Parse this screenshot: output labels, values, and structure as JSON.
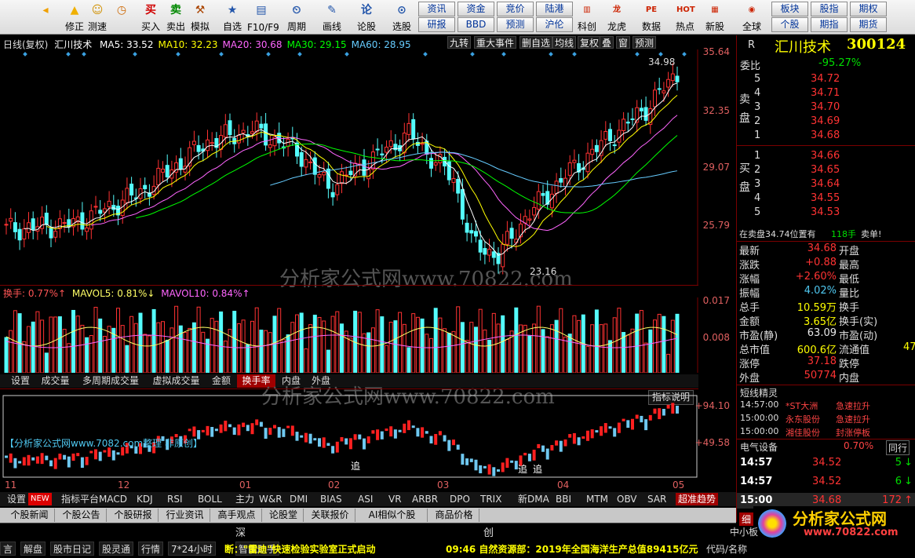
{
  "toolbar": {
    "items": [
      {
        "label": "",
        "icon": "◂",
        "name": "back-icon"
      },
      {
        "label": "修正",
        "icon": "▲",
        "name": "up-arrow-icon"
      },
      {
        "label": "测速",
        "icon": "☺",
        "name": "smiley-icon"
      },
      {
        "label": "",
        "icon": "◷",
        "name": "clock-icon"
      },
      {
        "label": "买入",
        "icon": "买",
        "name": "buy-icon"
      },
      {
        "label": "卖出",
        "icon": "卖",
        "name": "sell-icon"
      },
      {
        "label": "模拟",
        "icon": "⚒",
        "name": "hammer-icon"
      },
      {
        "label": "自选",
        "icon": "★",
        "name": "star-icon"
      },
      {
        "label": "F10/F9",
        "icon": "▤",
        "name": "f10-icon"
      },
      {
        "label": "周期",
        "icon": "⏲",
        "name": "period-icon"
      },
      {
        "label": "画线",
        "icon": "✎",
        "name": "pencil-icon"
      },
      {
        "label": "论股",
        "icon": "论",
        "name": "discuss-icon"
      },
      {
        "label": "选股",
        "icon": "⊙",
        "name": "select-stock-icon"
      }
    ],
    "mini": [
      "资讯",
      "资金",
      "竞价",
      "陆港",
      "研报",
      "BBD",
      "预测",
      "沪伦"
    ],
    "right_items": [
      {
        "label": "科创",
        "icon": "▥",
        "name": "chart-icon"
      },
      {
        "label": "龙虎",
        "icon": "龙",
        "name": "dragon-icon"
      },
      {
        "label": "数据",
        "icon": "PE",
        "name": "pe-icon"
      },
      {
        "label": "热点",
        "icon": "HOT",
        "name": "hot-icon"
      },
      {
        "label": "新股",
        "icon": "▦",
        "name": "ipo-icon"
      },
      {
        "label": "全球",
        "icon": "◉",
        "name": "globe-icon"
      }
    ],
    "mini_right": [
      "板块",
      "股指",
      "期权",
      "个股",
      "期指",
      "期货"
    ]
  },
  "chart": {
    "title_left": "日线(复权)",
    "stock": "汇川技术",
    "ma": [
      {
        "label": "MA5: 33.52",
        "color": "#ffffff"
      },
      {
        "label": "MA10: 32.23",
        "color": "#ffff00"
      },
      {
        "label": "MA20: 30.68",
        "color": "#ff66ff"
      },
      {
        "label": "MA30: 29.15",
        "color": "#00ff00"
      },
      {
        "label": "MA60: 28.95",
        "color": "#66ccff"
      }
    ],
    "top_buttons": [
      "九转",
      "重大事件",
      "删自选",
      "均线",
      "复权",
      "叠",
      "窗",
      "预测"
    ],
    "price_axis": [
      "35.64",
      "32.35",
      "29.07",
      "25.79"
    ],
    "high_label": "34.98",
    "low_label": "23.16",
    "watermark": "分析家公式网www.70822.com",
    "vol_title": {
      "hs": "换手: 0.77%↑",
      "mv5": "MAVOL5: 0.81%↓",
      "mv10": "MAVOL10: 0.84%↑"
    },
    "vol_axis": [
      "0.017",
      "0.008"
    ],
    "vol_tabs": [
      "设置",
      "成交量",
      "多周期成交量",
      "虚拟成交量",
      "金额",
      "换手率",
      "内盘",
      "外盘"
    ],
    "ind_note": "【分析家公式网www.7082.com整理 非原创】",
    "ind_button": "指标说明",
    "ind_axis": [
      "+94.10",
      "+49.58"
    ],
    "zhui": "追",
    "months": [
      "11",
      "12",
      "01",
      "02",
      "03",
      "04",
      "05"
    ],
    "ind_tabs": [
      "设置",
      "NEW",
      "指标平台",
      "MACD",
      "KDJ",
      "RSI",
      "BOLL",
      "主力",
      "W&R",
      "DMI",
      "BIAS",
      "ASI",
      "VR",
      "ARBR",
      "DPO",
      "TRIX",
      "新DMA",
      "BBI",
      "MTM",
      "OBV",
      "SAR",
      "超准趋势"
    ],
    "news_tabs": [
      "个股新闻",
      "个股公告",
      "个股研报",
      "行业资讯",
      "高手观点",
      "论股堂",
      "关联报价",
      "AI相似个股",
      "商品价格"
    ]
  },
  "chart_data": {
    "type": "candlestick",
    "title": "汇川技术 日线(复权)",
    "ylim": [
      23.16,
      35.64
    ],
    "x": [
      "11",
      "12",
      "01",
      "02",
      "03",
      "04",
      "05"
    ],
    "close_approx": [
      25.3,
      25.6,
      26.2,
      26.8,
      27.9,
      29.1,
      30.3,
      31.1,
      30.5,
      29.0,
      28.4,
      29.6,
      30.8,
      31.5,
      30.2,
      28.6,
      26.4,
      24.1,
      23.6,
      24.8,
      26.1,
      27.0,
      28.4,
      29.8,
      31.2,
      32.9,
      34.68
    ]
  },
  "quote": {
    "code_prefix": "R",
    "name": "汇川技术",
    "code": "300124",
    "weibi_label": "委比",
    "weibi": "-95.27%",
    "sell_label": "卖盘",
    "buy_label": "买盘",
    "sell": [
      {
        "n": "5",
        "p": "34.72"
      },
      {
        "n": "4",
        "p": "34.71"
      },
      {
        "n": "3",
        "p": "34.70"
      },
      {
        "n": "2",
        "p": "34.69"
      },
      {
        "n": "1",
        "p": "34.68"
      }
    ],
    "buy": [
      {
        "n": "1",
        "p": "34.66"
      },
      {
        "n": "2",
        "p": "34.65"
      },
      {
        "n": "3",
        "p": "34.64"
      },
      {
        "n": "4",
        "p": "34.55"
      },
      {
        "n": "5",
        "p": "34.53"
      }
    ],
    "status": "在卖盘34.74位置有",
    "status_vol": "118手",
    "status_tag": "卖单!",
    "stats": [
      {
        "l": "最新",
        "v": "34.68",
        "vc": "red",
        "r": "开盘"
      },
      {
        "l": "涨跌",
        "v": "+0.88",
        "vc": "red",
        "r": "最高"
      },
      {
        "l": "涨幅",
        "v": "+2.60%",
        "vc": "red",
        "r": "最低"
      },
      {
        "l": "振幅",
        "v": "4.02%",
        "vc": "cyan",
        "r": "量比"
      },
      {
        "l": "总手",
        "v": "10.59万",
        "vc": "yellow",
        "r": "换手"
      },
      {
        "l": "金额",
        "v": "3.65亿",
        "vc": "yellow",
        "r": "换手(实)"
      },
      {
        "l": "市盈(静)",
        "v": "63.09",
        "vc": "white",
        "r": "市盈(动)"
      },
      {
        "l": "总市值",
        "v": "600.6亿",
        "vc": "yellow",
        "r": "流通值"
      },
      {
        "l": "涨停",
        "v": "37.18",
        "vc": "red",
        "r": "跌停"
      },
      {
        "l": "外盘",
        "v": "50774",
        "vc": "red",
        "r": "内盘"
      }
    ],
    "flow_value_cut": "47",
    "dx_title": "短线精灵",
    "dx": [
      {
        "t": "14:57:00",
        "n": "*ST大洲",
        "e": "急速拉升"
      },
      {
        "t": "15:00:00",
        "n": "永东股份",
        "e": "急速拉升"
      },
      {
        "t": "15:00:00",
        "n": "湘佳股份",
        "e": "封涨停板"
      }
    ],
    "sector": "电气设备",
    "sector_pct": "0.70%",
    "sector_btn": "同行",
    "ticks": [
      {
        "t": "14:57",
        "p": "34.52",
        "v": "5",
        "dir": "down"
      },
      {
        "t": "14:57",
        "p": "34.52",
        "v": "6",
        "dir": "down"
      },
      {
        "t": "15:00",
        "p": "34.68",
        "v": "172",
        "dir": "up"
      }
    ]
  },
  "bottom": {
    "row1": [
      "深",
      "创"
    ],
    "left": [
      "言",
      "解盘",
      "股市日记",
      "股灵通",
      "行情",
      "7*24小时",
      "智能助手"
    ],
    "ticker1": "断：\"雷迪\"快速检验实验室正式启动",
    "ticker2": "09:46 自然资源部：2019年全国海洋生产总值89415亿元",
    "right": [
      "代码/名称"
    ],
    "logo_text": "分析家公式网",
    "logo_url": "www.70822.com",
    "mini_right": [
      "细",
      "中小板"
    ]
  }
}
